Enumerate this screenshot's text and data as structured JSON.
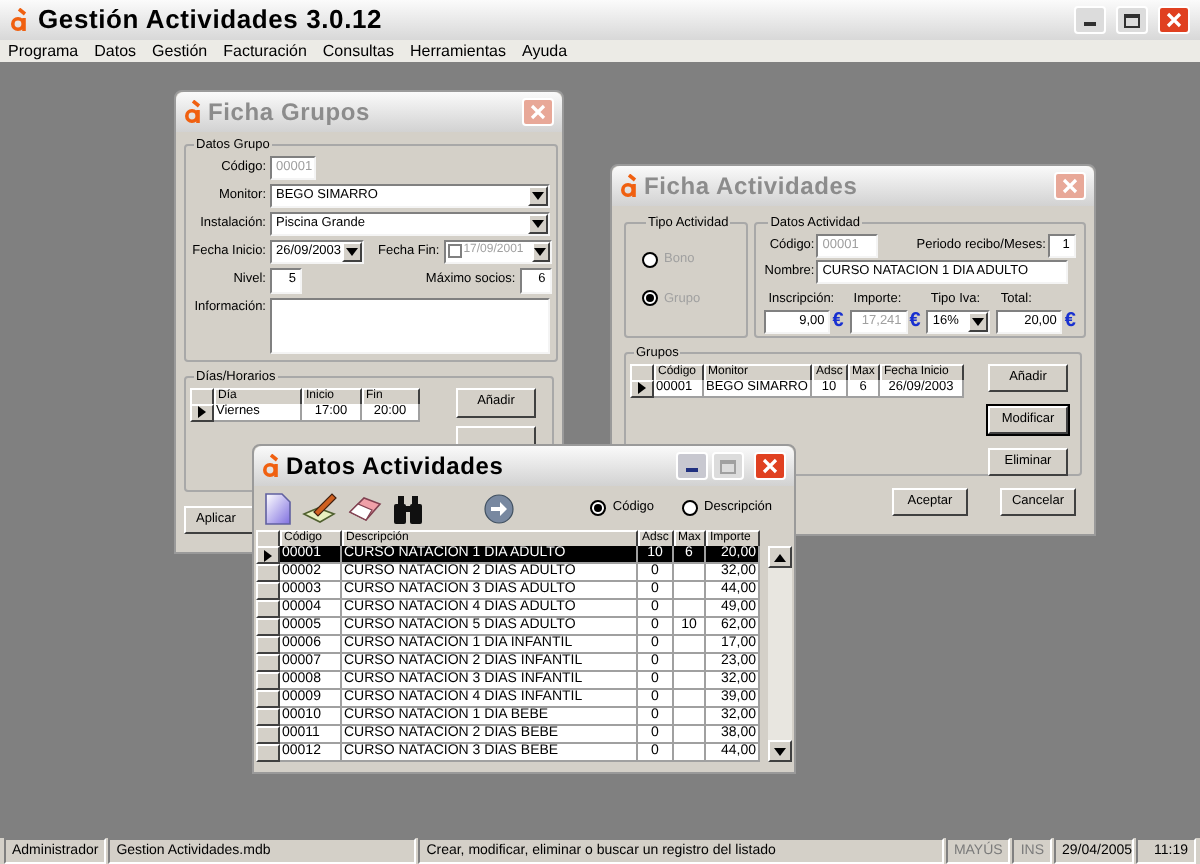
{
  "app": {
    "title": "Gestión Actividades 3.0.12"
  },
  "menu": [
    "Programa",
    "Datos",
    "Gestión",
    "Facturación",
    "Consultas",
    "Herramientas",
    "Ayuda"
  ],
  "ficha_grupos": {
    "title": "Ficha Grupos",
    "active": false,
    "group_label": "Datos Grupo",
    "codigo_label": "Código:",
    "codigo": "00001",
    "monitor_label": "Monitor:",
    "monitor": "BEGO SIMARRO",
    "instalacion_label": "Instalación:",
    "instalacion": "Piscina Grande",
    "fecha_inicio_label": "Fecha Inicio:",
    "fecha_inicio": "26/09/2003",
    "fecha_fin_label": "Fecha Fin:",
    "fecha_fin_checked": false,
    "fecha_fin": "17/09/2001",
    "nivel_label": "Nivel:",
    "nivel": "5",
    "max_label": "Máximo socios:",
    "max": "6",
    "info_label": "Información:",
    "horarios_label": "Días/Horarios",
    "horarios_columns": [
      "Día",
      "Inicio",
      "Fin"
    ],
    "horarios_rows": [
      {
        "cells": [
          "Viernes",
          "17:00",
          "20:00"
        ],
        "selected": true
      }
    ],
    "buttons": [
      {
        "kind": "labeled",
        "label": "Añadir"
      },
      {
        "kind": "covered"
      }
    ],
    "apply": "Aplicar"
  },
  "ficha_actividades": {
    "title": "Ficha Actividades",
    "active": false,
    "tipo_label": "Tipo Actividad",
    "tipos": [
      {
        "label": "Bono",
        "selected": false
      },
      {
        "label": "Grupo",
        "selected": true
      }
    ],
    "datos_label": "Datos Actividad",
    "codigo_label": "Código:",
    "codigo": "00001",
    "periodo_label": "Periodo recibo/Meses:",
    "periodo": "1",
    "nombre_label": "Nombre:",
    "nombre": "CURSO NATACION 1 DIA ADULTO",
    "amounts": [
      {
        "kind": "field",
        "label": "Inscripción:",
        "value": "9,00",
        "currency": "€"
      },
      {
        "kind": "readonly",
        "label": "Importe:",
        "value": "17,241",
        "currency": "€"
      },
      {
        "kind": "combo",
        "label": "Tipo Iva:",
        "value": "16%"
      },
      {
        "kind": "field",
        "label": "Total:",
        "value": "20,00",
        "currency": "€"
      }
    ],
    "grupos_label": "Grupos",
    "columns": [
      "Código",
      "Monitor",
      "Adsc",
      "Max",
      "Fecha Inicio"
    ],
    "rows": [
      {
        "cells": [
          "00001",
          "BEGO SIMARRO",
          "10",
          "6",
          "26/09/2003"
        ],
        "selected": true
      }
    ],
    "side_buttons": [
      {
        "label": "Añadir",
        "default": false
      },
      {
        "label": "Modificar",
        "default": true
      },
      {
        "label": "Eliminar",
        "default": false
      }
    ],
    "footer_buttons": [
      "Aceptar",
      "Cancelar"
    ]
  },
  "datos_actividades": {
    "title": "Datos Actividades",
    "active": true,
    "search_by": [
      {
        "label": "Código",
        "selected": true
      },
      {
        "label": "Descripción",
        "selected": false
      }
    ],
    "columns": [
      "Código",
      "Descripción",
      "Adsc",
      "Max",
      "Importe"
    ],
    "rows": [
      {
        "codigo": "00001",
        "descripcion": "CURSO NATACION 1 DIA ADULTO",
        "adsc": "10",
        "max": "6",
        "importe": "20,00",
        "selected": true
      },
      {
        "codigo": "00002",
        "descripcion": "CURSO NATACION 2 DIAS ADULTO",
        "adsc": "0",
        "importe": "32,00",
        "selected": false
      },
      {
        "codigo": "00003",
        "descripcion": "CURSO NATACION 3 DIAS ADULTO",
        "adsc": "0",
        "importe": "44,00",
        "selected": false
      },
      {
        "codigo": "00004",
        "descripcion": "CURSO NATACION 4 DIAS ADULTO",
        "adsc": "0",
        "importe": "49,00",
        "selected": false
      },
      {
        "codigo": "00005",
        "descripcion": "CURSO NATACION 5 DIAS ADULTO",
        "adsc": "0",
        "max": "10",
        "importe": "62,00",
        "selected": false
      },
      {
        "codigo": "00006",
        "descripcion": "CURSO NATACION 1 DIA INFANTIL",
        "adsc": "0",
        "importe": "17,00",
        "selected": false
      },
      {
        "codigo": "00007",
        "descripcion": "CURSO NATACION 2 DIAS INFANTIL",
        "adsc": "0",
        "importe": "23,00",
        "selected": false
      },
      {
        "codigo": "00008",
        "descripcion": "CURSO NATACION 3 DIAS INFANTIL",
        "adsc": "0",
        "importe": "32,00",
        "selected": false
      },
      {
        "codigo": "00009",
        "descripcion": "CURSO NATACION 4 DIAS INFANTIL",
        "adsc": "0",
        "importe": "39,00",
        "selected": false
      },
      {
        "codigo": "00010",
        "descripcion": "CURSO NATACION 1 DIA BEBE",
        "adsc": "0",
        "importe": "32,00",
        "selected": false
      },
      {
        "codigo": "00011",
        "descripcion": "CURSO NATACION 2 DIAS BEBE",
        "adsc": "0",
        "importe": "38,00",
        "selected": false
      },
      {
        "codigo": "00012",
        "descripcion": "CURSO NATACION 3 DIAS BEBE",
        "adsc": "0",
        "importe": "44,00",
        "selected": false
      }
    ]
  },
  "status_bar": [
    {
      "text": "Administrador",
      "disabled": false
    },
    {
      "text": "Gestion Actividades.mdb",
      "disabled": false
    },
    {
      "text": "Crear, modificar, eliminar o buscar un registro del listado",
      "disabled": false
    },
    {
      "text": "MAYÚS",
      "disabled": true
    },
    {
      "text": "INS",
      "disabled": true
    },
    {
      "text": "29/04/2005",
      "disabled": false
    },
    {
      "text": "11:19",
      "disabled": false
    }
  ]
}
